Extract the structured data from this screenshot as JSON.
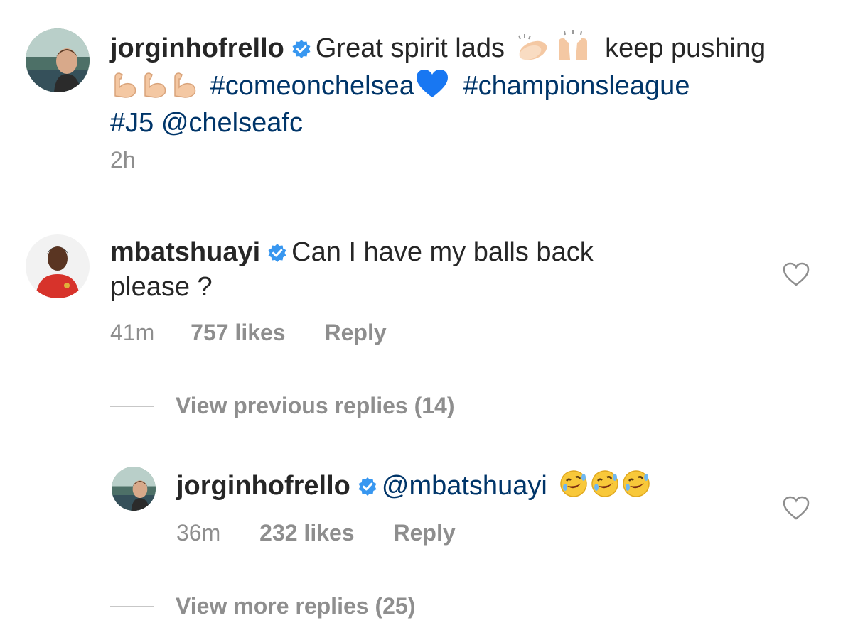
{
  "post": {
    "username": "jorginhofrello",
    "caption_text": "Great spirit lads",
    "caption_text2": "keep pushing",
    "hashtag1": "#comeonchelsea",
    "hashtag2": "#championsleague",
    "hashtag3": "#J5",
    "mention": "@chelseafc",
    "time": "2h"
  },
  "comment": {
    "username": "mbatshuayi",
    "text_line1": "Can I have my balls back",
    "text_line2": "please ?",
    "time": "41m",
    "likes": "757 likes",
    "reply_label": "Reply"
  },
  "view_previous": "View previous replies (14)",
  "reply": {
    "username": "jorginhofrello",
    "mention": "@mbatshuayi",
    "time": "36m",
    "likes": "232 likes",
    "reply_label": "Reply"
  },
  "view_more": "View more replies (25)",
  "colors": {
    "link": "#003569",
    "verified": "#3897f0",
    "meta": "#8e8e8e",
    "heart_blue": "#1877f2"
  },
  "icons": [
    "verified-badge-icon",
    "clapping-hands-icon",
    "raising-hands-icon",
    "flexed-biceps-icon",
    "blue-heart-icon",
    "rofl-emoji-icon",
    "heart-outline-icon"
  ]
}
